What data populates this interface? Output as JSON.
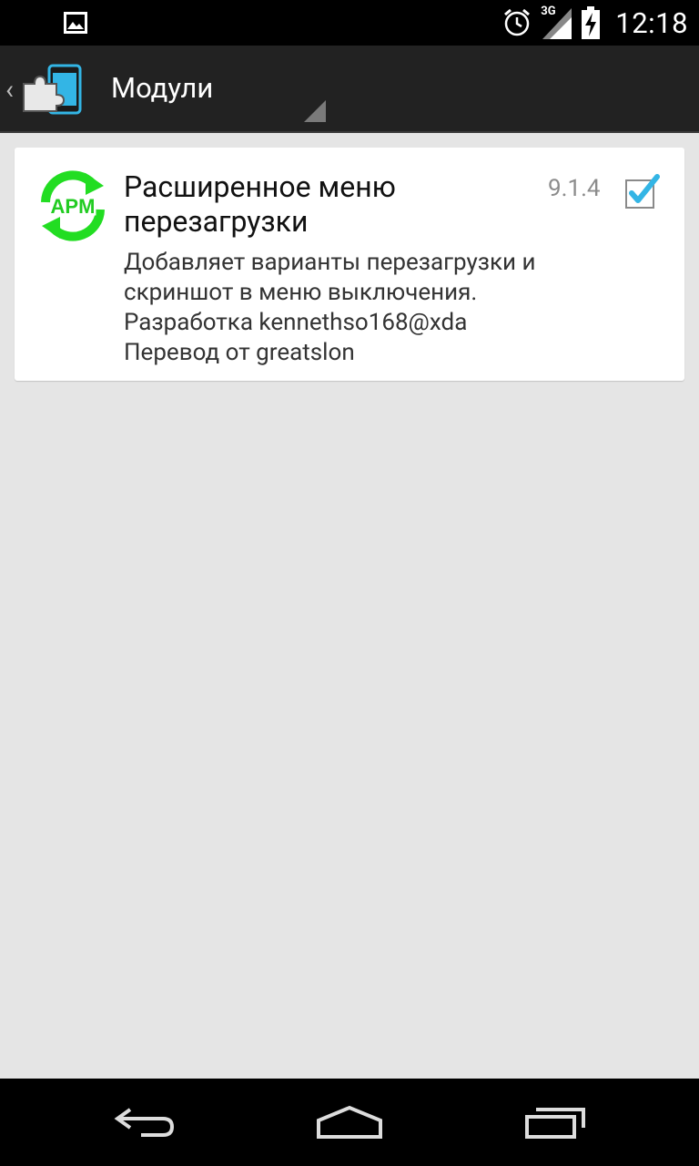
{
  "status_bar": {
    "time": "12:18",
    "network_type": "3G",
    "icons": [
      "image-notification-icon",
      "alarm-icon",
      "signal-icon",
      "battery-charging-icon"
    ]
  },
  "action_bar": {
    "title": "Модули",
    "logo_icon": "xposed-puzzle-icon"
  },
  "modules": [
    {
      "icon_text": "APM",
      "title_line1": "Расширенное меню",
      "title_line2": "перезагрузки",
      "version": "9.1.4",
      "enabled": true,
      "description": [
        "Добавляет варианты перезагрузки и",
        "скриншот в меню выключения.",
        "Разработка kennethso168@xda",
        "Перевод от greatslon"
      ]
    }
  ],
  "colors": {
    "background": "#e5e5e5",
    "action_bar": "#222222",
    "accent_blue": "#33b5e5",
    "apm_green": "#22dd22"
  },
  "nav_bar": {
    "icons": [
      "back-icon",
      "home-icon",
      "recents-icon"
    ]
  }
}
